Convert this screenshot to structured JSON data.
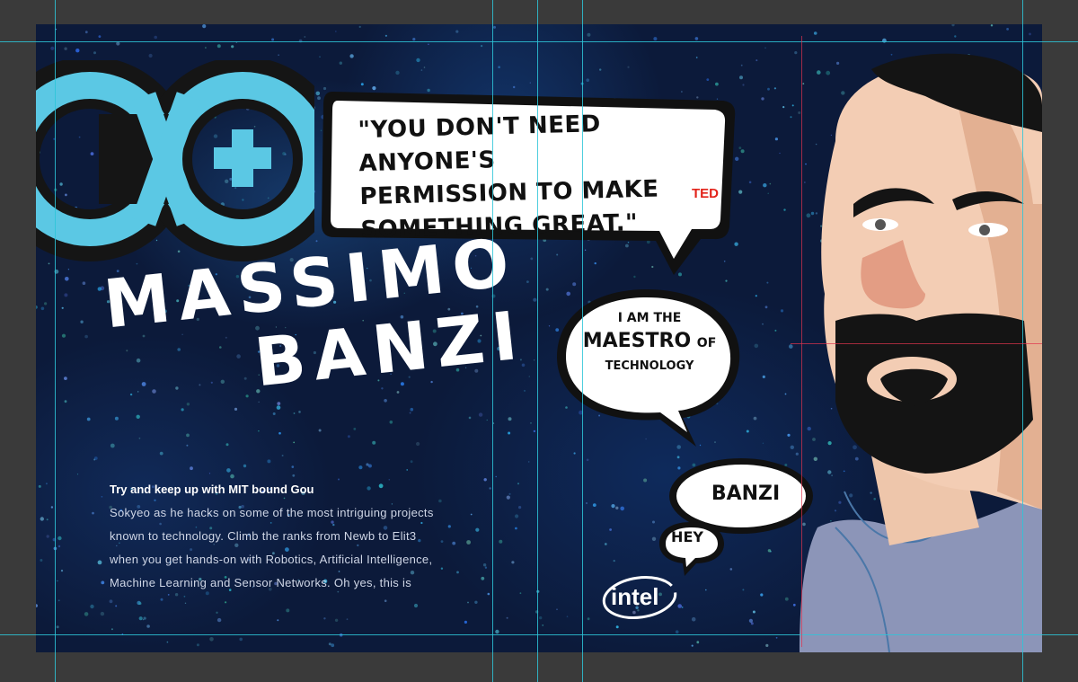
{
  "quote": {
    "lines": [
      "\"YOU DON'T NEED ANYONE'S",
      "PERMISSION TO MAKE",
      "SOMETHING GREAT.\""
    ],
    "source": "TED"
  },
  "maestro_bubble": {
    "line1": "I AM THE",
    "emphasis": "MAESTRO",
    "suffix": "OF",
    "line3": "TECHNOLOGY"
  },
  "banzi_bubble": "BANZI",
  "hey_bubble": "HEY",
  "title": {
    "line1": "MASSIMO",
    "line2": "BANZI"
  },
  "blurb": {
    "lead": "Try and keep up with  MIT bound Gou",
    "lines": [
      "Sokyeo as he hacks on some of the most intriguing projects",
      "known to technology. Climb the ranks from Newb to Elit3",
      "when you get hands-on with Robotics, Artificial Intelligence,",
      "Machine Learning and Sensor Networks. Oh yes, this is"
    ]
  },
  "brand": {
    "intel_label": "intel"
  },
  "colors": {
    "arduino_teal": "#5bc8e4",
    "guide_cyan": "#2ec5d8",
    "guide_red": "#e0334d",
    "background_navy": "#0c1a3a",
    "ted_red": "#e2231a"
  }
}
